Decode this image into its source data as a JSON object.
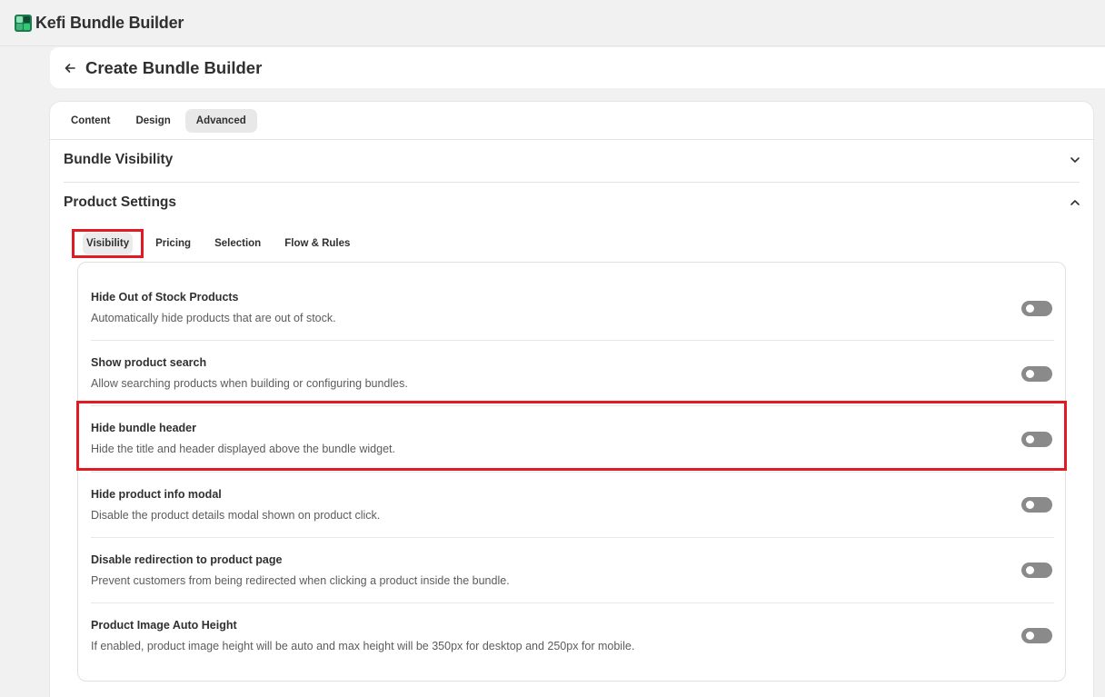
{
  "app": {
    "name": "Kefi Bundle Builder",
    "logo_icon": "kefi-logo-icon"
  },
  "header": {
    "title": "Create Bundle Builder",
    "back_icon": "arrow-left-icon"
  },
  "tabs": [
    {
      "label": "Content",
      "active": false
    },
    {
      "label": "Design",
      "active": false
    },
    {
      "label": "Advanced",
      "active": true
    }
  ],
  "sections": {
    "bundle_visibility": {
      "title": "Bundle Visibility",
      "state": "collapsed",
      "icon": "chevron-down-icon"
    },
    "product_settings": {
      "title": "Product Settings",
      "state": "expanded",
      "icon": "chevron-up-icon"
    }
  },
  "subtabs": [
    {
      "label": "Visibility",
      "active": true
    },
    {
      "label": "Pricing",
      "active": false
    },
    {
      "label": "Selection",
      "active": false
    },
    {
      "label": "Flow & Rules",
      "active": false
    }
  ],
  "settings": [
    {
      "title": "Hide Out of Stock Products",
      "description": "Automatically hide products that are out of stock.",
      "enabled": false
    },
    {
      "title": "Show product search",
      "description": "Allow searching products when building or configuring bundles.",
      "enabled": false
    },
    {
      "title": "Hide bundle header",
      "description": "Hide the title and header displayed above the bundle widget.",
      "enabled": false
    },
    {
      "title": "Hide product info modal",
      "description": "Disable the product details modal shown on product click.",
      "enabled": false
    },
    {
      "title": "Disable redirection to product page",
      "description": "Prevent customers from being redirected when clicking a product inside the bundle.",
      "enabled": false
    },
    {
      "title": "Product Image Auto Height",
      "description": "If enabled, product image height will be auto and max height will be 350px for desktop and 250px for mobile.",
      "enabled": false
    }
  ],
  "colors": {
    "highlight": "#e01b24",
    "toggle_off": "#8a8a8a",
    "text": "#303030"
  }
}
